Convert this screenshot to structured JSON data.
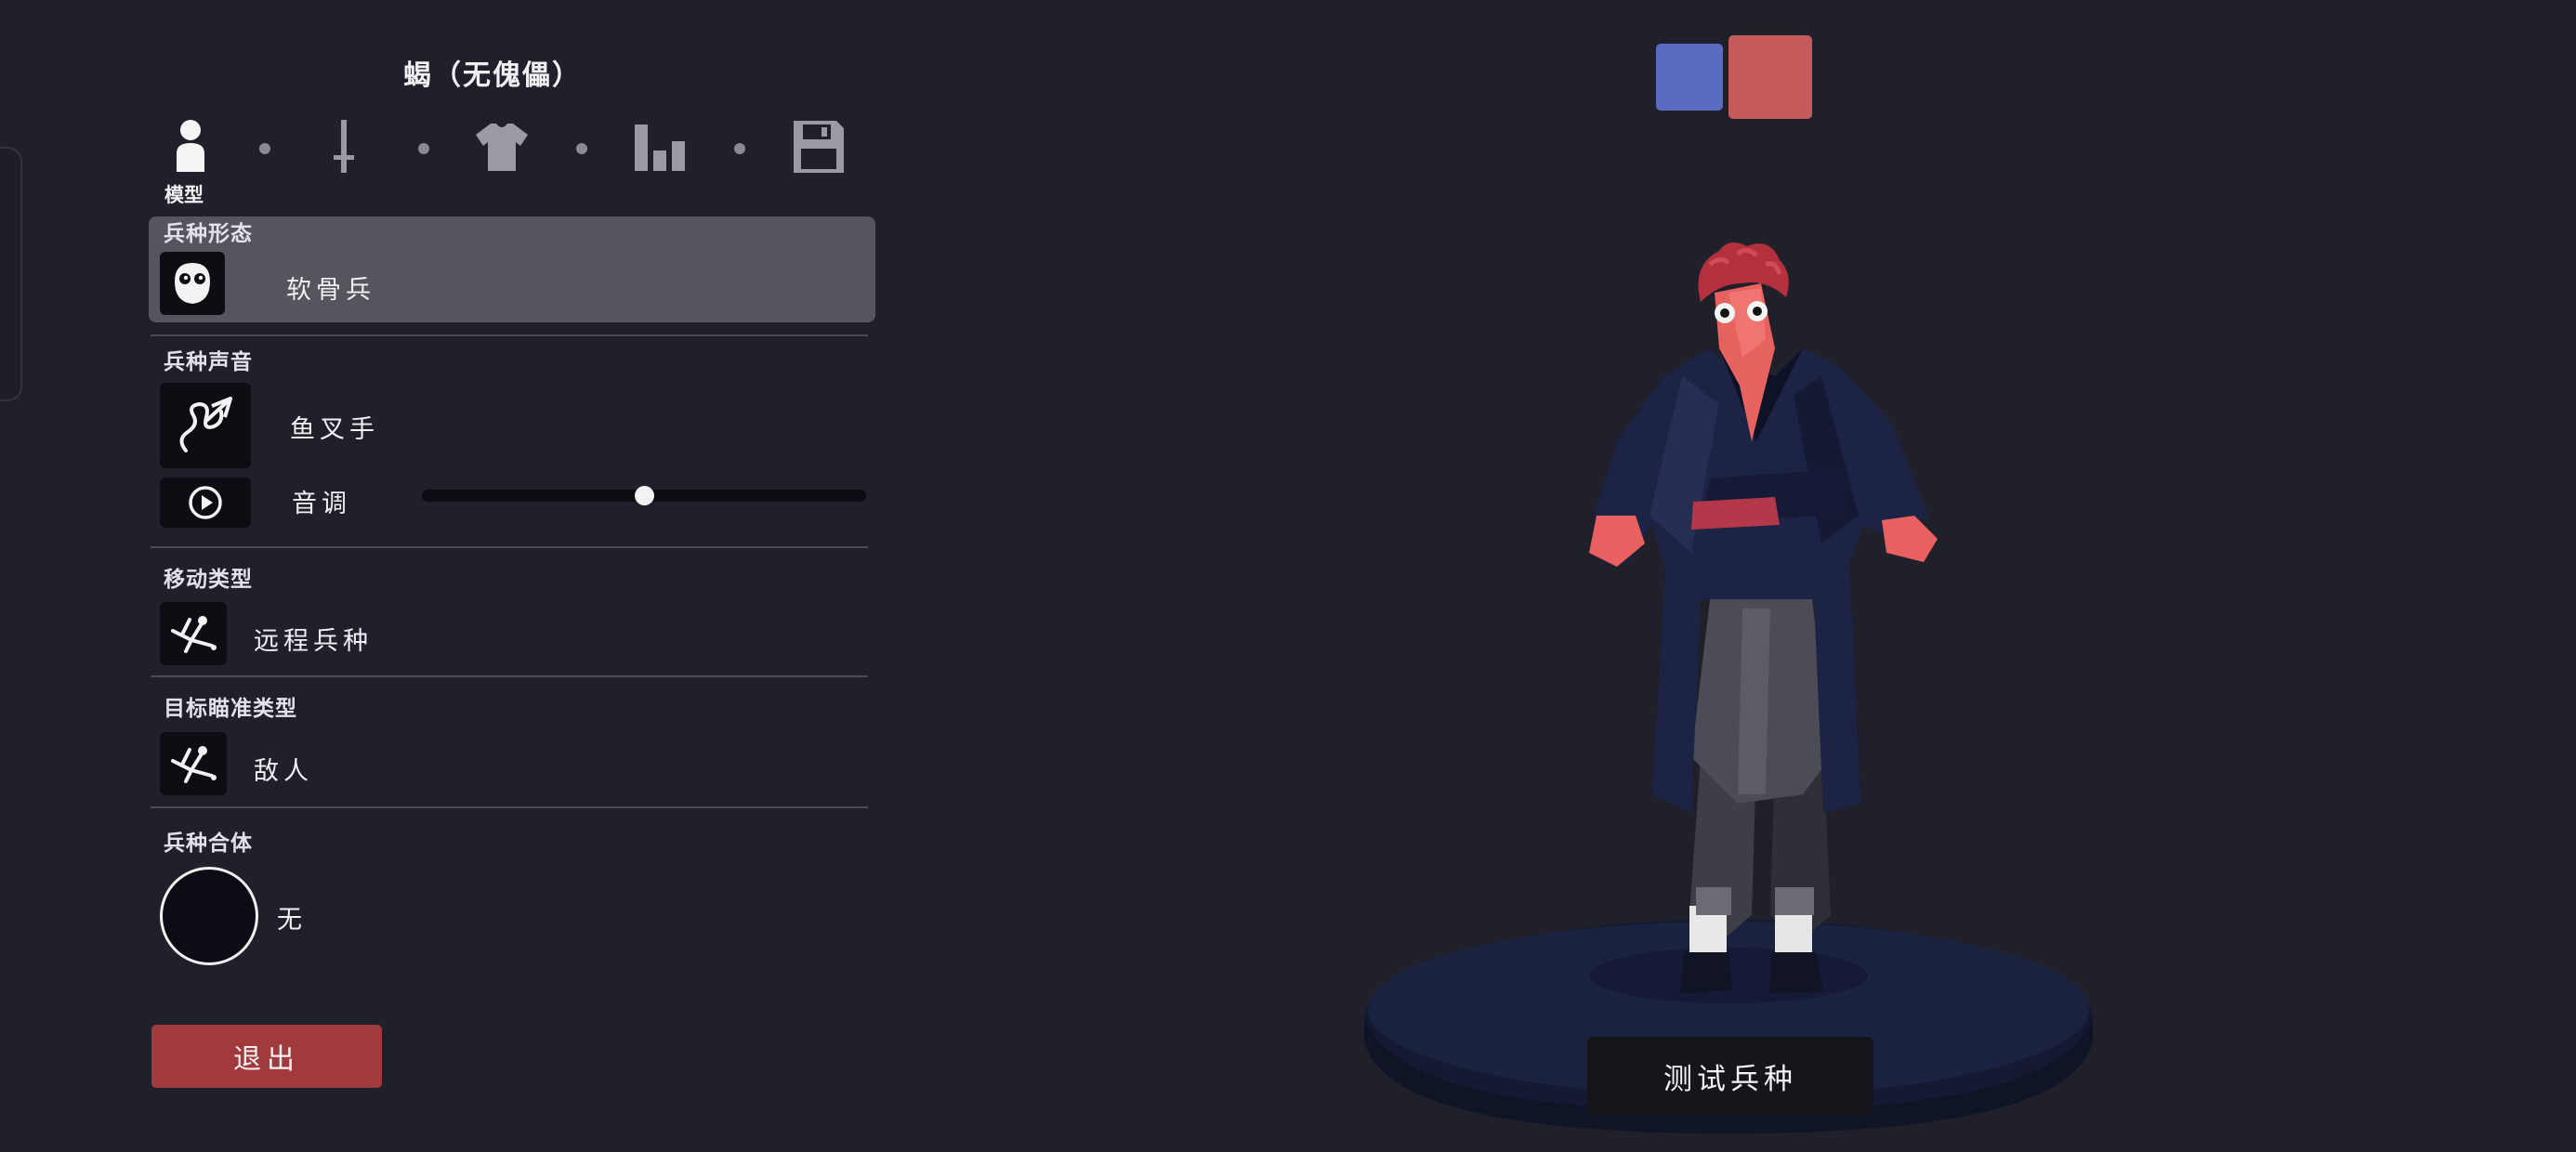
{
  "title": "蝎（无傀儡）",
  "tabs": [
    {
      "name": "model",
      "icon": "person-icon",
      "label": "模型",
      "active": true
    },
    {
      "name": "weapon",
      "icon": "sword-icon"
    },
    {
      "name": "clothing",
      "icon": "shirt-icon"
    },
    {
      "name": "stats",
      "icon": "bar-chart-icon"
    },
    {
      "name": "save",
      "icon": "floppy-disk-icon"
    }
  ],
  "sections": {
    "form": {
      "label": "兵种形态",
      "value": "软骨兵",
      "icon": "mask-face-icon"
    },
    "voice": {
      "label": "兵种声音",
      "value": "鱼叉手",
      "icon": "squiggle-arrow-icon",
      "pitch_label": "音调",
      "pitch_value": 0.5,
      "play_icon": "play-circle-icon"
    },
    "movement": {
      "label": "移动类型",
      "value": "远程兵种",
      "icon": "stickman-fall-icon"
    },
    "targeting": {
      "label": "目标瞄准类型",
      "value": "敌人",
      "icon": "stickman-fall-icon"
    },
    "combine": {
      "label": "兵种合体",
      "value": "无"
    }
  },
  "exit_label": "退出",
  "test_label": "测试兵种",
  "team_colors": {
    "blue": "#5a6bc2",
    "red": "#c45a59",
    "selected": "red"
  },
  "colors": {
    "background": "#20202b",
    "exit_button": "#a13a3c",
    "highlight_row": "#55555e"
  }
}
